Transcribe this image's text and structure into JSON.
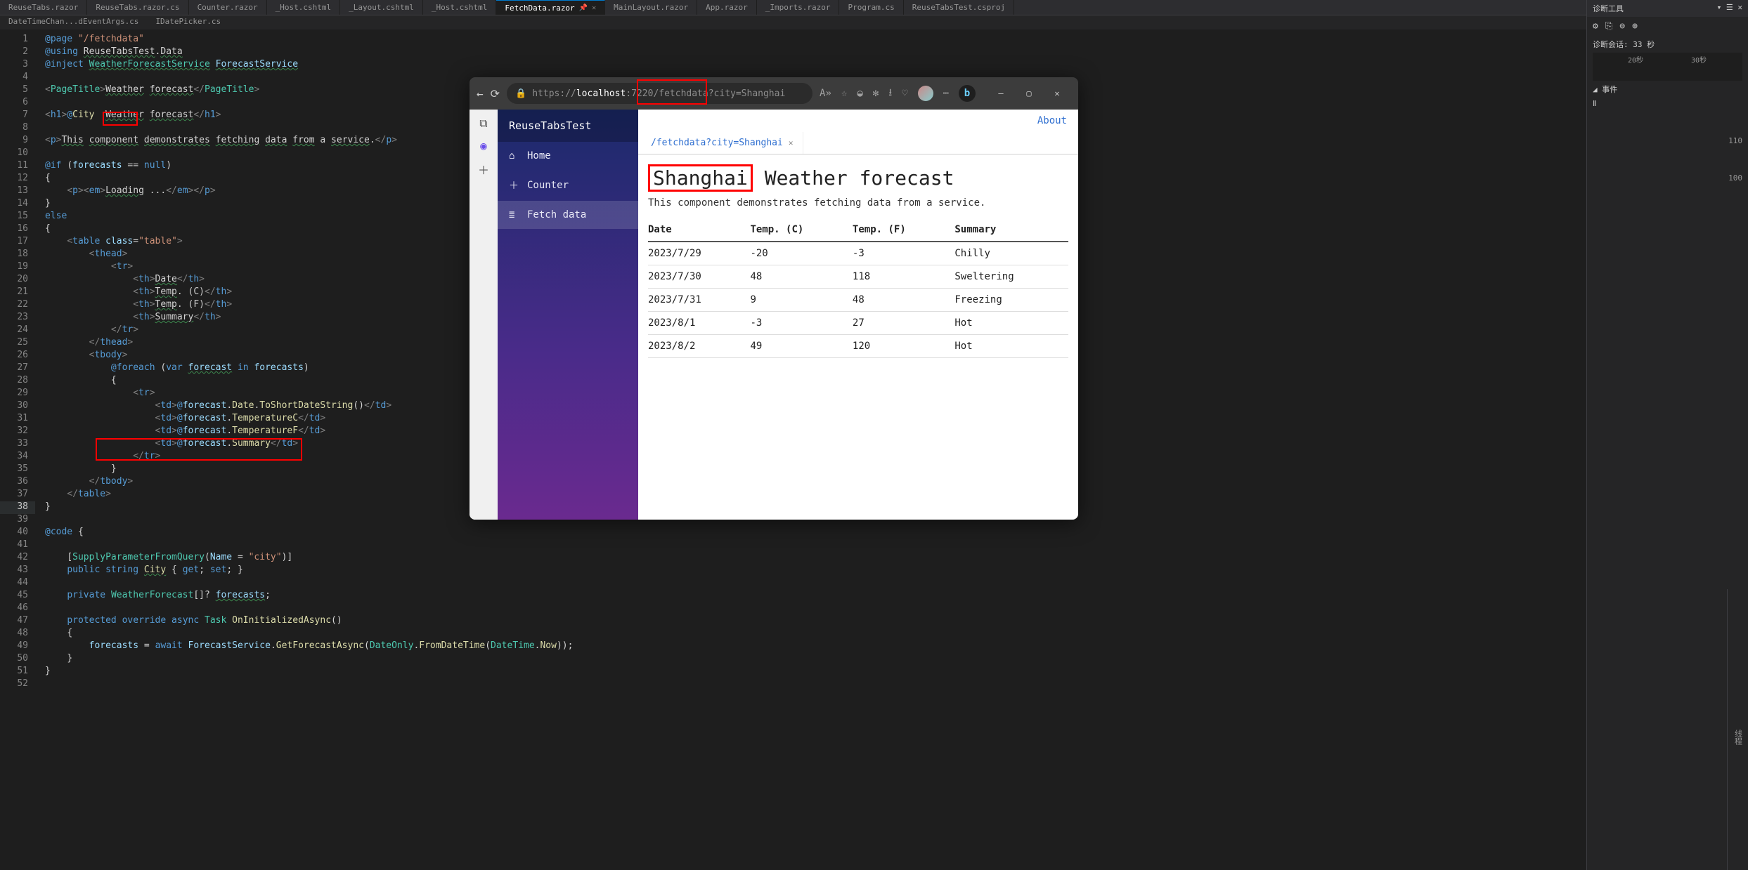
{
  "vs_tabs": [
    {
      "label": "ReuseTabs.razor",
      "active": false
    },
    {
      "label": "ReuseTabs.razor.cs",
      "active": false
    },
    {
      "label": "Counter.razor",
      "active": false
    },
    {
      "label": "_Host.cshtml",
      "active": false
    },
    {
      "label": "_Layout.cshtml",
      "active": false
    },
    {
      "label": "_Host.cshtml",
      "active": false
    },
    {
      "label": "FetchData.razor",
      "active": true
    },
    {
      "label": "MainLayout.razor",
      "active": false
    },
    {
      "label": "App.razor",
      "active": false
    },
    {
      "label": "_Imports.razor",
      "active": false
    },
    {
      "label": "Program.cs",
      "active": false
    },
    {
      "label": "ReuseTabsTest.csproj",
      "active": false
    }
  ],
  "sub_tabs": [
    {
      "label": "DateTimeChan...dEventArgs.cs"
    },
    {
      "label": "IDatePicker.cs"
    }
  ],
  "diag": {
    "title": "诊断工具",
    "session": "诊断会话: 33 秒",
    "ticks": [
      "20秒",
      "30秒"
    ],
    "events": "◢ 事件",
    "pause": "Ⅱ",
    "scale100": "100",
    "scale110": "110",
    "thread": "线程"
  },
  "editor": {
    "lines": [
      {
        "n": 1,
        "html": "<span class='c-kw'>@page</span> <span class='c-str'>\"/fetchdata\"</span>"
      },
      {
        "n": 2,
        "html": "<span class='c-kw'>@using</span> <span class='c-plain und'>ReuseTabsTest</span><span class='c-plain'>.</span><span class='c-plain und'>Data</span>"
      },
      {
        "n": 3,
        "html": "<span class='c-kw'>@inject</span> <span class='c-type und'>WeatherForecastService</span> <span class='c-var und'>ForecastService</span>"
      },
      {
        "n": 4,
        "html": ""
      },
      {
        "n": 5,
        "html": "<span class='c-tag'>&lt;</span><span class='c-type'>PageTitle</span><span class='c-tag'>&gt;</span><span class='c-plain und'>Weather</span> <span class='c-plain und'>forecast</span><span class='c-tag'>&lt;/</span><span class='c-type'>PageTitle</span><span class='c-tag'>&gt;</span>"
      },
      {
        "n": 6,
        "html": ""
      },
      {
        "n": 7,
        "html": "<span class='c-tag'>&lt;</span><span class='c-tagname'>h1</span><span class='c-tag'>&gt;</span><span class='c-kw'>@</span><span class='c-ident'>City</span>  <span class='c-plain und'>Weather</span> <span class='c-plain und'>forecast</span><span class='c-tag'>&lt;/</span><span class='c-tagname'>h1</span><span class='c-tag'>&gt;</span>"
      },
      {
        "n": 8,
        "html": ""
      },
      {
        "n": 9,
        "html": "<span class='c-tag'>&lt;</span><span class='c-tagname'>p</span><span class='c-tag'>&gt;</span><span class='c-plain und'>This</span> <span class='c-plain und'>component</span> <span class='c-plain und'>demonstrates</span> <span class='c-plain und'>fetching</span> <span class='c-plain und'>data</span> <span class='c-plain und'>from</span> <span class='c-plain'>a</span> <span class='c-plain und'>service</span>.<span class='c-tag'>&lt;/</span><span class='c-tagname'>p</span><span class='c-tag'>&gt;</span>"
      },
      {
        "n": 10,
        "html": ""
      },
      {
        "n": 11,
        "html": "<span class='c-kw'>@if</span> <span class='c-punc'>(</span><span class='c-var'>forecasts</span> <span class='c-punc'>==</span> <span class='c-kw'>null</span><span class='c-punc'>)</span>"
      },
      {
        "n": 12,
        "html": "<span class='c-punc'>{</span>"
      },
      {
        "n": 13,
        "html": "    <span class='c-tag'>&lt;</span><span class='c-tagname'>p</span><span class='c-tag'>&gt;&lt;</span><span class='c-tagname'>em</span><span class='c-tag'>&gt;</span><span class='c-plain und'>Loading</span> ...<span class='c-tag'>&lt;/</span><span class='c-tagname'>em</span><span class='c-tag'>&gt;&lt;/</span><span class='c-tagname'>p</span><span class='c-tag'>&gt;</span>"
      },
      {
        "n": 14,
        "html": "<span class='c-punc'>}</span>"
      },
      {
        "n": 15,
        "html": "<span class='c-kw'>else</span>"
      },
      {
        "n": 16,
        "html": "<span class='c-punc'>{</span>"
      },
      {
        "n": 17,
        "html": "    <span class='c-tag'>&lt;</span><span class='c-tagname'>table</span> <span class='c-attr'>class</span><span class='c-punc'>=</span><span class='c-str'>\"table\"</span><span class='c-tag'>&gt;</span>"
      },
      {
        "n": 18,
        "html": "        <span class='c-tag'>&lt;</span><span class='c-tagname'>thead</span><span class='c-tag'>&gt;</span>"
      },
      {
        "n": 19,
        "html": "            <span class='c-tag'>&lt;</span><span class='c-tagname'>tr</span><span class='c-tag'>&gt;</span>"
      },
      {
        "n": 20,
        "html": "                <span class='c-tag'>&lt;</span><span class='c-tagname'>th</span><span class='c-tag'>&gt;</span><span class='c-plain und'>Date</span><span class='c-tag'>&lt;/</span><span class='c-tagname'>th</span><span class='c-tag'>&gt;</span>"
      },
      {
        "n": 21,
        "html": "                <span class='c-tag'>&lt;</span><span class='c-tagname'>th</span><span class='c-tag'>&gt;</span><span class='c-plain und'>Temp</span>. (C)<span class='c-tag'>&lt;/</span><span class='c-tagname'>th</span><span class='c-tag'>&gt;</span>"
      },
      {
        "n": 22,
        "html": "                <span class='c-tag'>&lt;</span><span class='c-tagname'>th</span><span class='c-tag'>&gt;</span><span class='c-plain und'>Temp</span>. (F)<span class='c-tag'>&lt;/</span><span class='c-tagname'>th</span><span class='c-tag'>&gt;</span>"
      },
      {
        "n": 23,
        "html": "                <span class='c-tag'>&lt;</span><span class='c-tagname'>th</span><span class='c-tag'>&gt;</span><span class='c-plain und'>Summary</span><span class='c-tag'>&lt;/</span><span class='c-tagname'>th</span><span class='c-tag'>&gt;</span>"
      },
      {
        "n": 24,
        "html": "            <span class='c-tag'>&lt;/</span><span class='c-tagname'>tr</span><span class='c-tag'>&gt;</span>"
      },
      {
        "n": 25,
        "html": "        <span class='c-tag'>&lt;/</span><span class='c-tagname'>thead</span><span class='c-tag'>&gt;</span>"
      },
      {
        "n": 26,
        "html": "        <span class='c-tag'>&lt;</span><span class='c-tagname'>tbody</span><span class='c-tag'>&gt;</span>"
      },
      {
        "n": 27,
        "html": "            <span class='c-kw'>@foreach</span> <span class='c-punc'>(</span><span class='c-kw'>var</span> <span class='c-var und'>forecast</span> <span class='c-kw'>in</span> <span class='c-var'>forecasts</span><span class='c-punc'>)</span>"
      },
      {
        "n": 28,
        "html": "            <span class='c-punc'>{</span>"
      },
      {
        "n": 29,
        "html": "                <span class='c-tag'>&lt;</span><span class='c-tagname'>tr</span><span class='c-tag'>&gt;</span>"
      },
      {
        "n": 30,
        "html": "                    <span class='c-tag'>&lt;</span><span class='c-tagname'>td</span><span class='c-tag'>&gt;</span><span class='c-kw'>@</span><span class='c-var'>forecast</span>.<span class='c-prop'>Date</span>.<span class='c-yellow'>ToShortDateString</span><span class='c-punc'>()</span><span class='c-tag'>&lt;/</span><span class='c-tagname'>td</span><span class='c-tag'>&gt;</span>"
      },
      {
        "n": 31,
        "html": "                    <span class='c-tag'>&lt;</span><span class='c-tagname'>td</span><span class='c-tag'>&gt;</span><span class='c-kw'>@</span><span class='c-var'>forecast</span>.<span class='c-prop'>TemperatureC</span><span class='c-tag'>&lt;/</span><span class='c-tagname'>td</span><span class='c-tag'>&gt;</span>"
      },
      {
        "n": 32,
        "html": "                    <span class='c-tag'>&lt;</span><span class='c-tagname'>td</span><span class='c-tag'>&gt;</span><span class='c-kw'>@</span><span class='c-var'>forecast</span>.<span class='c-prop'>TemperatureF</span><span class='c-tag'>&lt;/</span><span class='c-tagname'>td</span><span class='c-tag'>&gt;</span>"
      },
      {
        "n": 33,
        "html": "                    <span class='c-tag'>&lt;</span><span class='c-tagname'>td</span><span class='c-tag'>&gt;</span><span class='c-kw'>@</span><span class='c-var'>forecast</span>.<span class='c-prop'>Summary</span><span class='c-tag'>&lt;/</span><span class='c-tagname'>td</span><span class='c-tag'>&gt;</span>"
      },
      {
        "n": 34,
        "html": "                <span class='c-tag'>&lt;/</span><span class='c-tagname'>tr</span><span class='c-tag'>&gt;</span>"
      },
      {
        "n": 35,
        "html": "            <span class='c-punc'>}</span>"
      },
      {
        "n": 36,
        "html": "        <span class='c-tag'>&lt;/</span><span class='c-tagname'>tbody</span><span class='c-tag'>&gt;</span>"
      },
      {
        "n": 37,
        "html": "    <span class='c-tag'>&lt;/</span><span class='c-tagname'>table</span><span class='c-tag'>&gt;</span>"
      },
      {
        "n": 38,
        "html": "<span class='c-punc'>}</span>"
      },
      {
        "n": 39,
        "html": ""
      },
      {
        "n": 40,
        "html": "<span class='c-kw'>@code</span> <span class='c-punc'>{</span>"
      },
      {
        "n": 41,
        "html": ""
      },
      {
        "n": 42,
        "html": "    <span class='c-punc'>[</span><span class='c-type'>SupplyParameterFromQuery</span><span class='c-punc'>(</span><span class='c-var'>Name</span> <span class='c-punc'>=</span> <span class='c-str'>\"city\"</span><span class='c-punc'>)]</span>"
      },
      {
        "n": 43,
        "html": "    <span class='c-kw'>public</span> <span class='c-kw'>string</span> <span class='c-prop und'>City</span> <span class='c-punc'>{</span> <span class='c-kw'>get</span><span class='c-punc'>;</span> <span class='c-kw'>set</span><span class='c-punc'>;</span> <span class='c-punc'>}</span>"
      },
      {
        "n": 44,
        "html": ""
      },
      {
        "n": 45,
        "html": "    <span class='c-kw'>private</span> <span class='c-type'>WeatherForecast</span><span class='c-punc'>[]?</span> <span class='c-var und'>forecasts</span><span class='c-punc'>;</span>"
      },
      {
        "n": 46,
        "html": ""
      },
      {
        "n": 47,
        "html": "    <span class='c-kw'>protected</span> <span class='c-kw'>override</span> <span class='c-kw'>async</span> <span class='c-type'>Task</span> <span class='c-yellow'>OnInitializedAsync</span><span class='c-punc'>()</span>"
      },
      {
        "n": 48,
        "html": "    <span class='c-punc'>{</span>"
      },
      {
        "n": 49,
        "html": "        <span class='c-var'>forecasts</span> <span class='c-punc'>=</span> <span class='c-kw'>await</span> <span class='c-var'>ForecastService</span>.<span class='c-yellow'>GetForecastAsync</span><span class='c-punc'>(</span><span class='c-type'>DateOnly</span>.<span class='c-yellow'>FromDateTime</span><span class='c-punc'>(</span><span class='c-type'>DateTime</span>.<span class='c-prop'>Now</span><span class='c-punc'>));</span>"
      },
      {
        "n": 50,
        "html": "    <span class='c-punc'>}</span>"
      },
      {
        "n": 51,
        "html": "<span class='c-punc'>}</span>"
      },
      {
        "n": 52,
        "html": ""
      }
    ],
    "current_line": 38
  },
  "browser": {
    "url_prefix": "https://",
    "url_host": "localhost",
    "url_rest": ":7220/fetchdata?city=Shanghai",
    "app_title": "ReuseTabsTest",
    "about": "About",
    "nav": [
      {
        "icon": "⌂",
        "label": "Home",
        "active": false
      },
      {
        "icon": "＋",
        "label": "Counter",
        "active": false
      },
      {
        "icon": "≣",
        "label": "Fetch data",
        "active": true
      }
    ],
    "tab_label": "/fetchdata?city=Shanghai",
    "h1_city": "Shanghai",
    "h1_rest": " Weather forecast",
    "sub": "This component demonstrates fetching data from a service.",
    "cols": [
      "Date",
      "Temp. (C)",
      "Temp. (F)",
      "Summary"
    ],
    "rows": [
      [
        "2023/7/29",
        "-20",
        "-3",
        "Chilly"
      ],
      [
        "2023/7/30",
        "48",
        "118",
        "Sweltering"
      ],
      [
        "2023/7/31",
        "9",
        "48",
        "Freezing"
      ],
      [
        "2023/8/1",
        "-3",
        "27",
        "Hot"
      ],
      [
        "2023/8/2",
        "49",
        "120",
        "Hot"
      ]
    ]
  }
}
